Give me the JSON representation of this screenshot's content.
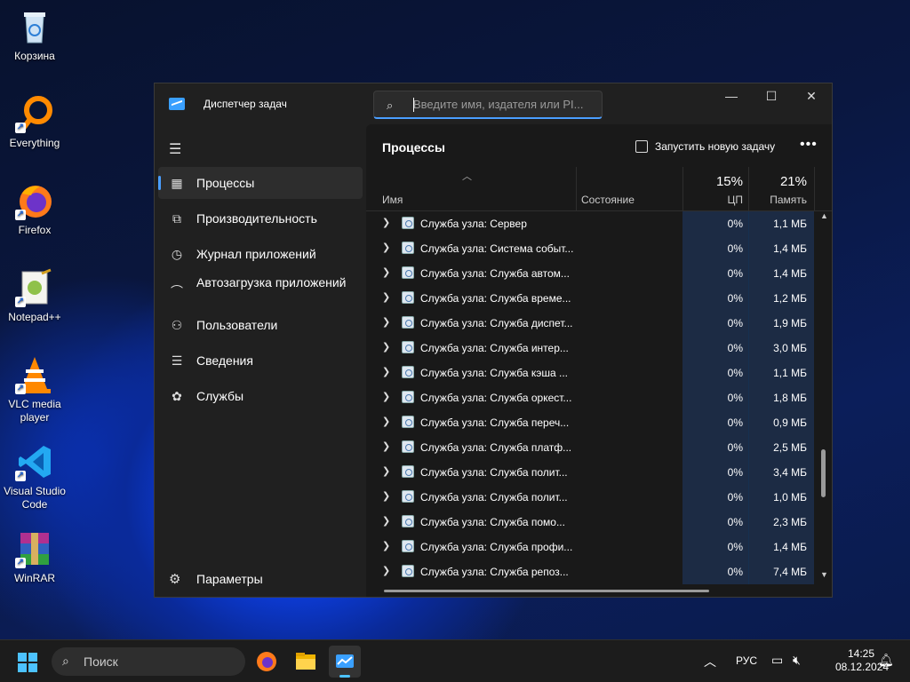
{
  "desktop": {
    "icons": [
      {
        "label": "Корзина"
      },
      {
        "label": "Everything"
      },
      {
        "label": "Firefox"
      },
      {
        "label": "Notepad++"
      },
      {
        "label": "VLC media player"
      },
      {
        "label": "Visual Studio Code"
      },
      {
        "label": "WinRAR"
      }
    ]
  },
  "window": {
    "title": "Диспетчер задач",
    "search_placeholder": "Введите имя, издателя или PI...",
    "controls": {
      "minimize": "—",
      "maximize": "☐",
      "close": "✕"
    }
  },
  "sidebar": {
    "menu_icon": "hamburger-icon",
    "items": [
      {
        "label": "Процессы",
        "icon": "processes-icon",
        "active": true
      },
      {
        "label": "Производительность",
        "icon": "performance-icon"
      },
      {
        "label": "Журнал приложений",
        "icon": "history-icon"
      },
      {
        "label": "Автозагрузка приложений",
        "icon": "startup-icon"
      },
      {
        "label": "Пользователи",
        "icon": "users-icon"
      },
      {
        "label": "Сведения",
        "icon": "details-icon"
      },
      {
        "label": "Службы",
        "icon": "services-icon"
      }
    ],
    "settings_label": "Параметры"
  },
  "main": {
    "title": "Процессы",
    "new_task_label": "Запустить новую задачу",
    "more_label": "•••",
    "columns": {
      "name": "Имя",
      "status": "Состояние",
      "cpu_percent": "15%",
      "cpu_label": "ЦП",
      "mem_percent": "21%",
      "mem_label": "Память"
    },
    "rows": [
      {
        "name": "Служба узла: Сервер",
        "cpu": "0%",
        "mem": "1,1 МБ"
      },
      {
        "name": "Служба узла: Система событ...",
        "cpu": "0%",
        "mem": "1,4 МБ"
      },
      {
        "name": "Служба узла: Служба автом...",
        "cpu": "0%",
        "mem": "1,4 МБ"
      },
      {
        "name": "Служба узла: Служба време...",
        "cpu": "0%",
        "mem": "1,2 МБ"
      },
      {
        "name": "Служба узла: Служба диспет...",
        "cpu": "0%",
        "mem": "1,9 МБ"
      },
      {
        "name": "Служба узла: Служба интер...",
        "cpu": "0%",
        "mem": "3,0 МБ"
      },
      {
        "name": "Служба узла: Служба кэша ...",
        "cpu": "0%",
        "mem": "1,1 МБ"
      },
      {
        "name": "Служба узла: Служба оркест...",
        "cpu": "0%",
        "mem": "1,8 МБ"
      },
      {
        "name": "Служба узла: Служба переч...",
        "cpu": "0%",
        "mem": "0,9 МБ"
      },
      {
        "name": "Служба узла: Служба платф...",
        "cpu": "0%",
        "mem": "2,5 МБ"
      },
      {
        "name": "Служба узла: Служба полит...",
        "cpu": "0%",
        "mem": "3,4 МБ"
      },
      {
        "name": "Служба узла: Служба полит...",
        "cpu": "0%",
        "mem": "1,0 МБ"
      },
      {
        "name": "Служба узла: Служба помо...",
        "cpu": "0%",
        "mem": "2,3 МБ"
      },
      {
        "name": "Служба узла: Служба профи...",
        "cpu": "0%",
        "mem": "1,4 МБ"
      },
      {
        "name": "Служба узла: Служба репоз...",
        "cpu": "0%",
        "mem": "7,4 МБ"
      }
    ]
  },
  "taskbar": {
    "search_label": "Поиск",
    "language": "РУС",
    "time": "14:25",
    "date": "08.12.2024"
  },
  "colors": {
    "accent": "#4a9eff",
    "window_bg": "#202020",
    "cpu_col": "#1c2b44"
  }
}
